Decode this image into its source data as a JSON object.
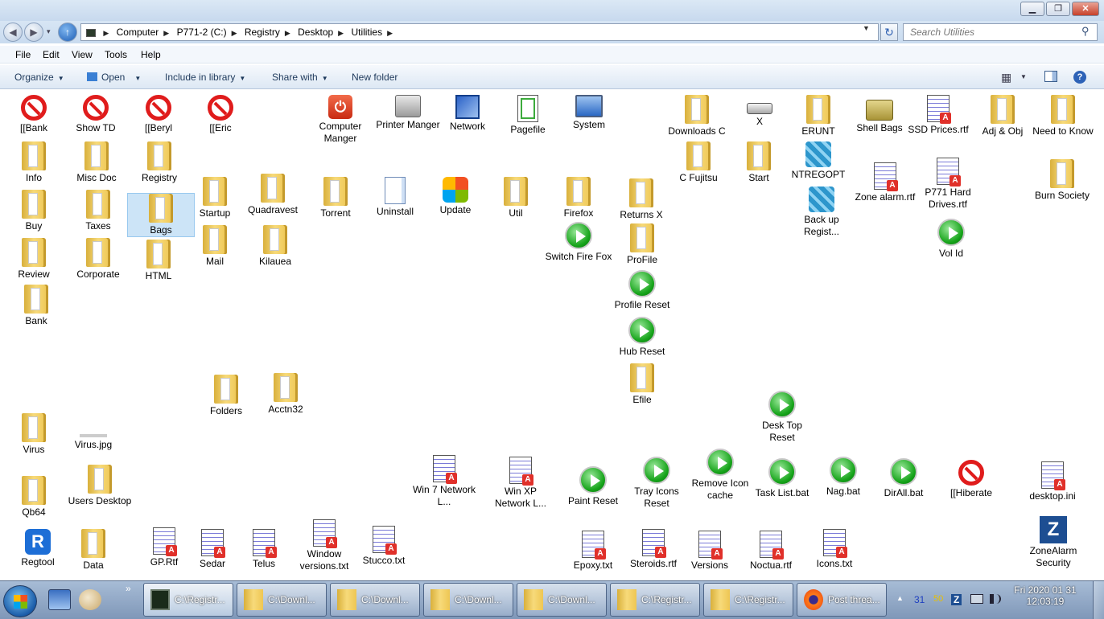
{
  "window": {
    "min": "▁",
    "max": "❐",
    "close": "✕",
    "back": "◀",
    "forward": "▶",
    "up": "↑",
    "recent": "▾",
    "breadcrumbs": [
      "Computer",
      "P771-2 (C:)",
      "Registry",
      "Desktop",
      "Utilities"
    ],
    "crumb_sep": "▶",
    "refresh": "↻",
    "search_placeholder": "Search Utilities",
    "menus": [
      "File",
      "Edit",
      "View",
      "Tools",
      "Help"
    ],
    "commands": {
      "organize": "Organize",
      "open": "Open",
      "include": "Include in library",
      "share": "Share with",
      "newfolder": "New folder"
    },
    "dropdown_arrow": "▼",
    "help": "?"
  },
  "items": [
    {
      "label": "[[Bank",
      "icon": "noentry"
    },
    {
      "label": "Show TD",
      "icon": "noentry"
    },
    {
      "label": "[[Beryl",
      "icon": "noentry"
    },
    {
      "label": "[[Eric",
      "icon": "noentry"
    },
    {
      "label": "Computer Manger",
      "icon": "power"
    },
    {
      "label": "Printer Manger",
      "icon": "printer"
    },
    {
      "label": "Network",
      "icon": "network"
    },
    {
      "label": "Pagefile",
      "icon": "pagefile"
    },
    {
      "label": "System",
      "icon": "system"
    },
    {
      "label": "Downloads C",
      "icon": "folder"
    },
    {
      "label": "X",
      "icon": "drive"
    },
    {
      "label": "ERUNT",
      "icon": "folder"
    },
    {
      "label": "Shell Bags",
      "icon": "bag"
    },
    {
      "label": "SSD Prices.rtf",
      "icon": "doc"
    },
    {
      "label": "Adj & Obj",
      "icon": "folder"
    },
    {
      "label": "Need to Know",
      "icon": "folder"
    },
    {
      "label": "Info",
      "icon": "folder"
    },
    {
      "label": "Misc Doc",
      "icon": "folder"
    },
    {
      "label": "Registry",
      "icon": "folder"
    },
    {
      "label": "C Fujitsu",
      "icon": "folder"
    },
    {
      "label": "Start",
      "icon": "folder"
    },
    {
      "label": "NTREGOPT",
      "icon": "cubes"
    },
    {
      "label": "Zone alarm.rtf",
      "icon": "doc"
    },
    {
      "label": "P771 Hard Drives.rtf",
      "icon": "doc"
    },
    {
      "label": "Burn Society",
      "icon": "folder"
    },
    {
      "label": "Buy",
      "icon": "folder"
    },
    {
      "label": "Taxes",
      "icon": "folder"
    },
    {
      "label": "Bags",
      "icon": "folder"
    },
    {
      "label": "Startup",
      "icon": "folder"
    },
    {
      "label": "Quadravest",
      "icon": "folder"
    },
    {
      "label": "Torrent",
      "icon": "folder"
    },
    {
      "label": "Uninstall",
      "icon": "uninstall"
    },
    {
      "label": "Update",
      "icon": "update"
    },
    {
      "label": "Util",
      "icon": "folder"
    },
    {
      "label": "Firefox",
      "icon": "folder"
    },
    {
      "label": "Returns X",
      "icon": "folder"
    },
    {
      "label": "Back up Regist...",
      "icon": "cubes"
    },
    {
      "label": "Vol Id",
      "icon": "play"
    },
    {
      "label": "Review",
      "icon": "folder"
    },
    {
      "label": "Corporate",
      "icon": "folder"
    },
    {
      "label": "HTML",
      "icon": "folder"
    },
    {
      "label": "Mail",
      "icon": "folder"
    },
    {
      "label": "Kilauea",
      "icon": "folder"
    },
    {
      "label": "Switch Fire Fox",
      "icon": "play"
    },
    {
      "label": "ProFile",
      "icon": "folder"
    },
    {
      "label": "Bank",
      "icon": "folder"
    },
    {
      "label": "Profile Reset",
      "icon": "play"
    },
    {
      "label": "Hub Reset",
      "icon": "play"
    },
    {
      "label": "Efile",
      "icon": "folder"
    },
    {
      "label": "Folders",
      "icon": "folder"
    },
    {
      "label": "Acctn32",
      "icon": "folder"
    },
    {
      "label": "Desk Top Reset",
      "icon": "play"
    },
    {
      "label": "Virus",
      "icon": "folder"
    },
    {
      "label": "Virus.jpg",
      "icon": "jpg"
    },
    {
      "label": "Win 7 Network L...",
      "icon": "doc"
    },
    {
      "label": "Win XP Network L...",
      "icon": "doc"
    },
    {
      "label": "Paint Reset",
      "icon": "play"
    },
    {
      "label": "Tray Icons Reset",
      "icon": "play"
    },
    {
      "label": "Remove Icon cache",
      "icon": "play"
    },
    {
      "label": "Task List.bat",
      "icon": "play"
    },
    {
      "label": "Nag.bat",
      "icon": "play"
    },
    {
      "label": "DirAll.bat",
      "icon": "play"
    },
    {
      "label": "[[Hiberate",
      "icon": "noentry"
    },
    {
      "label": "desktop.ini",
      "icon": "doc"
    },
    {
      "label": "Qb64",
      "icon": "folder"
    },
    {
      "label": "Users Desktop",
      "icon": "folder"
    },
    {
      "label": "Regtool",
      "icon": "regtool"
    },
    {
      "label": "Data",
      "icon": "folder"
    },
    {
      "label": "GP.Rtf",
      "icon": "doc"
    },
    {
      "label": "Sedar",
      "icon": "doc"
    },
    {
      "label": "Telus",
      "icon": "doc"
    },
    {
      "label": "Window versions.txt",
      "icon": "doc"
    },
    {
      "label": "Stucco.txt",
      "icon": "doc"
    },
    {
      "label": "Epoxy.txt",
      "icon": "doc"
    },
    {
      "label": "Steroids.rtf",
      "icon": "doc"
    },
    {
      "label": "Versions",
      "icon": "doc"
    },
    {
      "label": "Noctua.rtf",
      "icon": "doc"
    },
    {
      "label": "Icons.txt",
      "icon": "doc"
    },
    {
      "label": "ZoneAlarm Security",
      "icon": "zonealarm"
    }
  ],
  "taskbar": {
    "more": "»",
    "buttons": [
      "C:\\Registr...",
      "C:\\Downl...",
      "C:\\Downl...",
      "C:\\Downl...",
      "C:\\Downl...",
      "C:\\Registr...",
      "C:\\Registr...",
      "Post threa..."
    ],
    "tray": {
      "up": "▲",
      "n1": "31",
      "n2": "50",
      "z": "Z"
    },
    "clock_date": "Fri 2020 01 31",
    "clock_time": "12:03:19"
  }
}
